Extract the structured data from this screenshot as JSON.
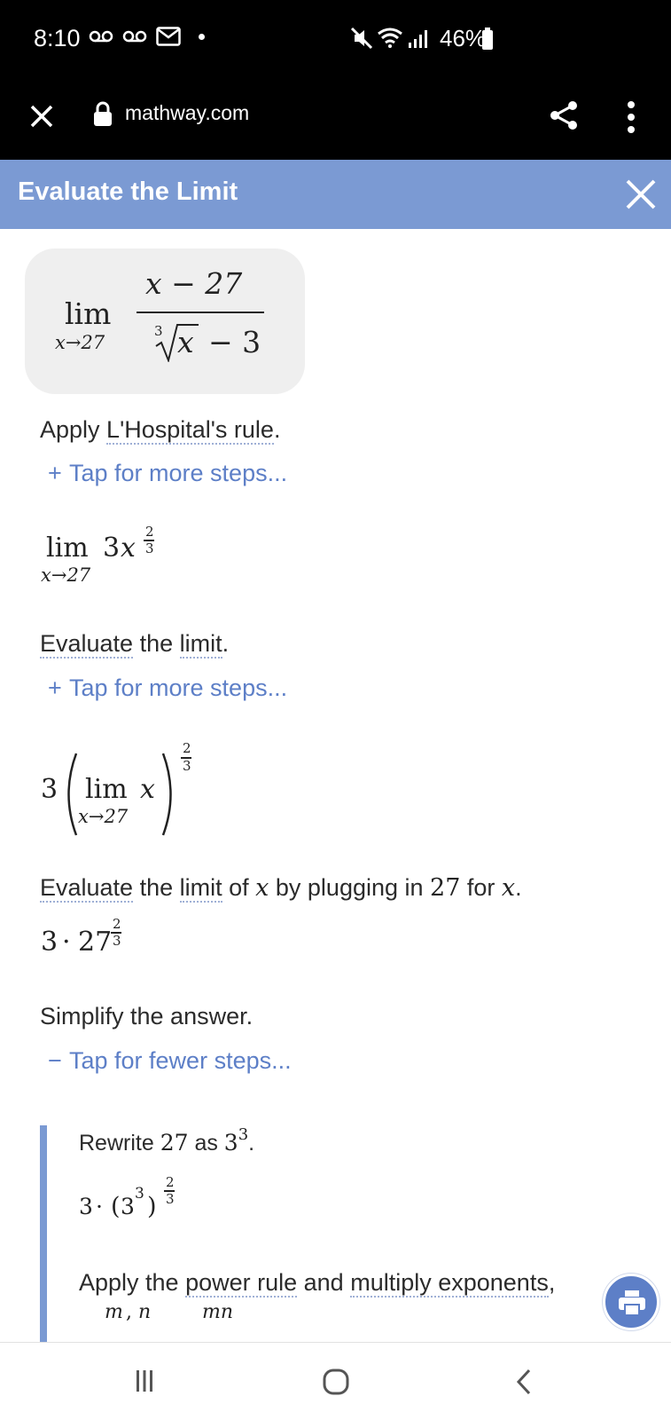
{
  "status_bar": {
    "time": "8:10",
    "battery": "46%"
  },
  "browser": {
    "url": "mathway.com"
  },
  "header": {
    "title": "Evaluate the Limit"
  },
  "problem": {
    "lim": "lim",
    "sub": "x→27",
    "numerator": "x − 27",
    "root_index": "3",
    "denominator_var": "x",
    "denominator_rest": "− 3"
  },
  "steps": [
    {
      "text_parts": [
        "Apply ",
        "L'Hospital's rule",
        "."
      ],
      "tap": "Tap for more steps...",
      "tap_sign": "+",
      "result": {
        "lim": "lim",
        "sub": "x→27",
        "coef": "3",
        "var": "x",
        "exp_num": "2",
        "exp_den": "3"
      }
    },
    {
      "text_parts": [
        "Evaluate",
        " the ",
        "limit",
        "."
      ],
      "tap": "Tap for more steps...",
      "tap_sign": "+",
      "result": {
        "coef": "3",
        "lim": "lim",
        "var": "x",
        "sub": "x→27",
        "exp_num": "2",
        "exp_den": "3"
      }
    },
    {
      "text_parts": [
        "Evaluate",
        " the ",
        "limit",
        " of ",
        "x",
        " by plugging in ",
        "27",
        " for ",
        "x",
        "."
      ],
      "result": {
        "coef": "3",
        "dot": "·",
        "base": "27",
        "exp_num": "2",
        "exp_den": "3"
      }
    },
    {
      "text_parts": [
        "Simplify the answer."
      ],
      "tap": "Tap for fewer steps...",
      "tap_sign": "−"
    }
  ],
  "substeps": [
    {
      "text_parts": [
        "Rewrite ",
        "27",
        " as ",
        "3",
        "3",
        "."
      ],
      "result": {
        "coef": "3",
        "dot": "·",
        "inner_base": "3",
        "inner_exp": "3",
        "exp_num": "2",
        "exp_den": "3"
      }
    },
    {
      "text_parts": [
        "Apply the ",
        "power rule",
        " and ",
        "multiply exponents",
        ","
      ],
      "partial": {
        "a": "m",
        "b": "n",
        "c": "mn"
      }
    }
  ],
  "colors": {
    "header_bg": "#7b9ad3",
    "link": "#5d7fc7",
    "problem_bg": "#efefef"
  }
}
